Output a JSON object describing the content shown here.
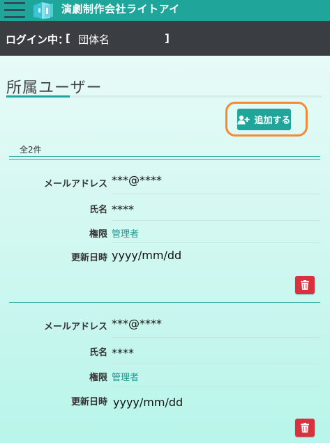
{
  "header": {
    "app_title": "演劇制作会社ライトアイ"
  },
  "login": {
    "label": "ログイン中：",
    "bracket_open": "[",
    "org_name": "団体名",
    "bracket_close": "]"
  },
  "section": {
    "title": "所属ユーザー",
    "add_label": "追加する",
    "count": "全2件"
  },
  "fields": {
    "email": "メールアドレス",
    "name": "氏名",
    "role": "権限",
    "updated": "更新日時"
  },
  "users": [
    {
      "email": "***@****",
      "name": "****",
      "role": "管理者",
      "updated": "yyyy/mm/dd"
    },
    {
      "email": "***@****",
      "name": "****",
      "role": "管理者",
      "updated": "yyyy/mm/dd"
    }
  ],
  "colors": {
    "accent": "#1fa59a",
    "highlight": "#f08a34",
    "danger": "#d9323f",
    "login_bar": "#3a3d42"
  }
}
